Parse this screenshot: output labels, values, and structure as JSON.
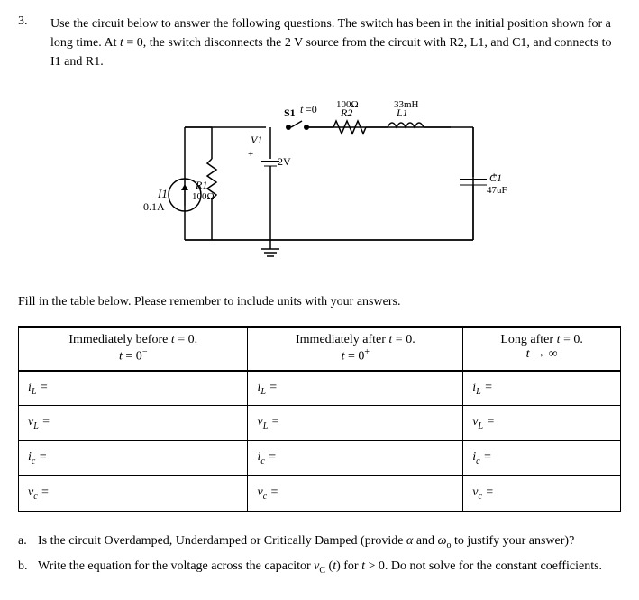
{
  "problem": {
    "number": "3.",
    "text": "Use the circuit below to answer the following questions. The switch has been in the initial position shown for a long time. At t = 0, the switch disconnects the 2 V source from the circuit with R2, L1, and C1, and connects to I1 and R1.",
    "fill_instruction": "Fill in the table below. Please remember to include units with your answers.",
    "columns": [
      "Immediately before t = 0.",
      "Immediately after t = 0.",
      "Long after t = 0."
    ],
    "col_sub": [
      "t = 0⁻",
      "t = 0⁺",
      "t → ∞"
    ],
    "rows": [
      {
        "label": "i_L =",
        "cols": [
          "i_L =",
          "i_L =",
          "i_L ="
        ]
      },
      {
        "label": "v_L =",
        "cols": [
          "v_L =",
          "v_L =",
          "v_L ="
        ]
      },
      {
        "label": "i_c =",
        "cols": [
          "i_c =",
          "i_c =",
          "i_c ="
        ]
      },
      {
        "label": "v_c =",
        "cols": [
          "v_c =",
          "v_c =",
          "v_c ="
        ]
      }
    ],
    "questions": [
      {
        "label": "a.",
        "text": "Is the circuit Overdamped, Underdamped or Critically Damped (provide α and ω₀ to justify your answer)?"
      },
      {
        "label": "b.",
        "text": "Write the equation for the voltage across the capacitor v_C (t) for t > 0. Do not solve for the constant coefficients."
      }
    ]
  }
}
